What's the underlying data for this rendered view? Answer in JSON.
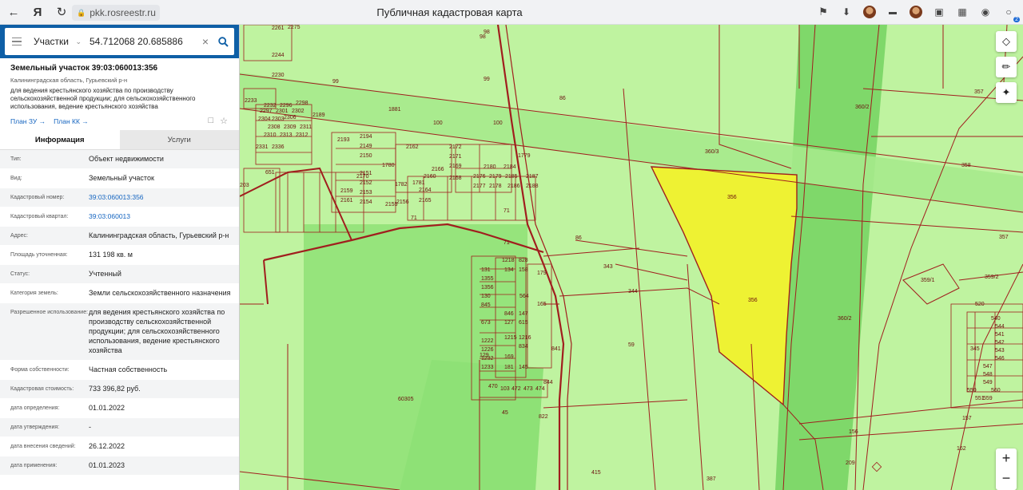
{
  "browser": {
    "url": "pkk.rosreestr.ru",
    "title": "Публичная кадастровая карта",
    "icons": [
      "back-icon",
      "yandex-icon",
      "reload-icon",
      "bookmark-icon",
      "download-icon",
      "extension-icons"
    ],
    "ext_badge": "2"
  },
  "search": {
    "type": "Участки",
    "value": "54.712068 20.685886",
    "placeholder": ""
  },
  "object": {
    "title": "Земельный участок 39:03:060013:356",
    "address": "Калининградская область, Гурьевский р-н",
    "use": "для ведения крестьянского хозяйства по производству сельскохозяйственной продукции; для сельскохозяйственного использования, ведение крестьянского хозяйства",
    "plan_zu": "План ЗУ →",
    "plan_kk": "План КК →"
  },
  "tabs": {
    "info": "Информация",
    "services": "Услуги"
  },
  "rows": [
    {
      "label": "Тип:",
      "value": "Объект недвижимости"
    },
    {
      "label": "Вид:",
      "value": "Земельный участок"
    },
    {
      "label": "Кадастровый номер:",
      "value": "39:03:060013:356"
    },
    {
      "label": "Кадастровый квартал:",
      "value": "39:03:060013"
    },
    {
      "label": "Адрес:",
      "value": "Калининградская область, Гурьевский р-н"
    },
    {
      "label": "Площадь уточненная:",
      "value": "131 198 кв. м"
    },
    {
      "label": "Статус:",
      "value": "Учтенный"
    },
    {
      "label": "Категория земель:",
      "value": "Земли сельскохозяйственного назначения"
    },
    {
      "label": "Разрешенное использование:",
      "value": "для ведения крестьянского хозяйства по производству сельскохозяйственной продукции; для сельскохозяйственного использования, ведение крестьянского хозяйства"
    },
    {
      "label": "Форма собственности:",
      "value": "Частная собственность"
    },
    {
      "label": "Кадастровая стоимость:",
      "value": "733 396,82 руб."
    },
    {
      "label": "дата определения:",
      "value": "01.01.2022"
    },
    {
      "label": "дата утверждения:",
      "value": "-"
    },
    {
      "label": "дата внесения сведений:",
      "value": "26.12.2022"
    },
    {
      "label": "дата применения:",
      "value": "01.01.2023"
    }
  ],
  "map": {
    "parcel_labels": [
      "98",
      "98",
      "86",
      "100",
      "100",
      "99",
      "99",
      "2230",
      "2275",
      "2261",
      "2244",
      "1881",
      "356",
      "356",
      "360/3",
      "360/2",
      "360/2",
      "358",
      "357",
      "357",
      "359/1",
      "359/2",
      "343",
      "344",
      "345",
      "59",
      "71",
      "71",
      "71",
      "86",
      "60305",
      "45",
      "822",
      "415",
      "387",
      "157",
      "156",
      "162",
      "209",
      "2193",
      "2194",
      "2149",
      "2150",
      "2162",
      "2172",
      "2171",
      "2169",
      "2180",
      "2184",
      "2185",
      "2186",
      "2187",
      "2188",
      "2176",
      "2179",
      "2177",
      "2178",
      "2166",
      "2168",
      "1782",
      "1781",
      "2164",
      "2165",
      "2156",
      "2155",
      "2154",
      "2153",
      "2152",
      "2151",
      "2161",
      "2170",
      "2159",
      "2160",
      "1780",
      "1779",
      "2189",
      "2233",
      "2232",
      "2296",
      "2298",
      "2297",
      "2301",
      "2302",
      "2304",
      "2303",
      "2306",
      "2308",
      "2309",
      "2311",
      "2310",
      "2313",
      "2312",
      "2331",
      "2336",
      "203",
      "651",
      "1218",
      "828",
      "134",
      "158",
      "131",
      "1355",
      "1356",
      "564",
      "130",
      "845",
      "846",
      "147",
      "127",
      "615",
      "673",
      "1222",
      "1215",
      "1216",
      "1226",
      "834",
      "1232",
      "169",
      "129",
      "1233",
      "181",
      "145",
      "179",
      "165",
      "470",
      "103",
      "472",
      "473",
      "474",
      "844",
      "841",
      "520",
      "540",
      "544",
      "541",
      "542",
      "543",
      "546",
      "547",
      "548",
      "549",
      "550",
      "551",
      "559",
      "560",
      "561"
    ],
    "colors": {
      "base": "#bff3a0",
      "highlight": "#eef233",
      "boundary": "#a01e1e",
      "dark_green": "#7fd86a"
    }
  }
}
